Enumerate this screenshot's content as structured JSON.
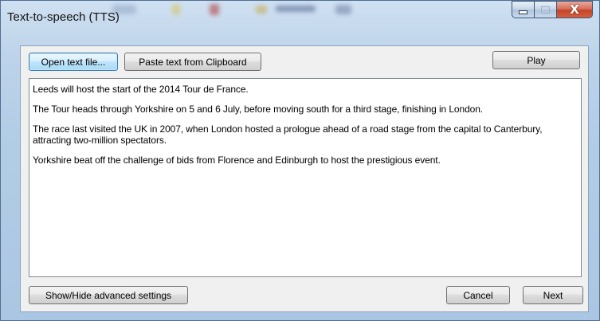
{
  "window": {
    "title": "Text-to-speech (TTS)",
    "controls": {
      "minimize_icon": "minimize-icon",
      "maximize_icon": "maximize-icon",
      "close_icon": "close-icon",
      "close_glyph": "X"
    }
  },
  "toolbar": {
    "open_file_label": "Open text file...",
    "paste_label": "Paste text from Clipboard",
    "play_label": "Play"
  },
  "text_content": [
    "Leeds will host the start of the 2014 Tour de France.",
    "The Tour heads through Yorkshire on 5 and 6 July, before moving south for a third stage, finishing in London.",
    "The race last visited the UK in 2007, when London hosted a prologue ahead of a road stage from the capital to Canterbury, attracting two-million spectators.",
    "Yorkshire beat off the challenge of bids from Florence and Edinburgh to host the prestigious event."
  ],
  "footer": {
    "advanced_label": "Show/Hide advanced settings",
    "cancel_label": "Cancel",
    "next_label": "Next"
  },
  "colors": {
    "frame": "#b4cde6",
    "close_button": "#c2452b",
    "focused_button_border": "#3c7fb1"
  }
}
